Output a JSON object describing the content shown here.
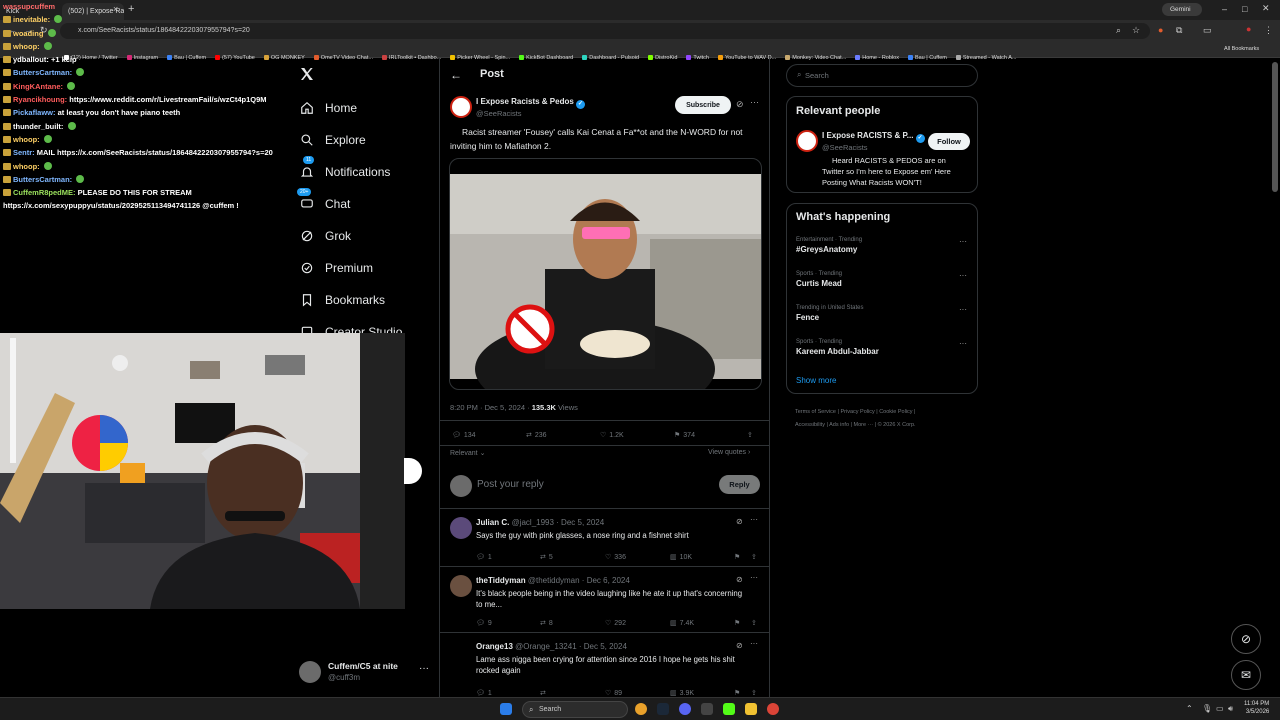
{
  "browser": {
    "tabs": [
      {
        "label": "Kick"
      },
      {
        "label": "(502) | Expose Racists & Pe"
      }
    ],
    "url": "x.com/SeeRacists/status/1864842220307955794?s=20",
    "gemini_label": "Gemini",
    "bookmarks": [
      {
        "label": "(12) Home / Twitter",
        "color": "#ffffff"
      },
      {
        "label": "Instagram",
        "color": "#d62976"
      },
      {
        "label": "Bau | Cuffem",
        "color": "#3b82f6"
      },
      {
        "label": "(57) YouTube",
        "color": "#ff0000"
      },
      {
        "label": "OG MONKEY",
        "color": "#d8a23a"
      },
      {
        "label": "OmeTV Video Chat...",
        "color": "#e25c2d"
      },
      {
        "label": "IRLToolkit • Dashbo...",
        "color": "#c94141"
      },
      {
        "label": "Picker Wheel - Spin...",
        "color": "#f0c000"
      },
      {
        "label": "KickBot Dashboard",
        "color": "#53fc18"
      },
      {
        "label": "Dashboard - Pulsoid",
        "color": "#2dd4bf"
      },
      {
        "label": "DistroKid",
        "color": "#7fff00"
      },
      {
        "label": "Twitch",
        "color": "#9146ff"
      },
      {
        "label": "YouTube to WAV D...",
        "color": "#f59e0b"
      },
      {
        "label": "Monkey: Video Chat...",
        "color": "#c8a96e"
      },
      {
        "label": "Home - Roblox",
        "color": "#6b7cff"
      },
      {
        "label": "Bau | Cuffem",
        "color": "#3b82f6"
      },
      {
        "label": "Streamed - Watch A...",
        "color": "#aaaaaa"
      }
    ],
    "all_bookmarks": "All Bookmarks"
  },
  "chat": {
    "lines": [
      {
        "user": "",
        "msg": "wassupcuffem",
        "color": "#ff6b6b"
      },
      {
        "user": "inevitable:",
        "msg": "",
        "color": "#ffd166"
      },
      {
        "user": "woading",
        "msg": "",
        "color": "#ffd166"
      },
      {
        "user": "whoop:",
        "msg": "",
        "color": "#ffd166"
      },
      {
        "user": "ydballout:",
        "msg": "+1 kcip",
        "color": "#ffffff"
      },
      {
        "user": "ButtersCartman:",
        "msg": "",
        "color": "#7fb7ff"
      },
      {
        "user": "KingKAntane:",
        "msg": "",
        "color": "#ff5c5c"
      },
      {
        "user": "Ryancikhoung:",
        "msg": "https://www.reddit.com/r/LivestreamFail/s/wzCt4p1Q9M",
        "color": "#ff5c5c"
      },
      {
        "user": "Pickaflaww:",
        "msg": "at least you don't have piano teeth",
        "color": "#7fb7ff"
      },
      {
        "user": "thunder_built:",
        "msg": "",
        "color": "#ffffff"
      },
      {
        "user": "whoop:",
        "msg": "",
        "color": "#ffd166"
      },
      {
        "user": "Sentr:",
        "msg": "MAIL https://x.com/SeeRacists/status/1864842220307955794?s=20",
        "color": "#7fb7ff"
      },
      {
        "user": "whoop:",
        "msg": "",
        "color": "#ffd166"
      },
      {
        "user": "ButtersCartman:",
        "msg": "",
        "color": "#7fb7ff"
      },
      {
        "user": "CuffemR8pedME:",
        "msg": "PLEASE DO THIS FOR STREAM",
        "color": "#9be15d"
      },
      {
        "user": "",
        "msg": "https://x.com/sexypuppyu/status/2029525113494741126 @cuffem !",
        "color": "#ffffff"
      }
    ]
  },
  "nav": {
    "items": [
      {
        "label": "Home",
        "icon": "home-icon"
      },
      {
        "label": "Explore",
        "icon": "search-icon"
      },
      {
        "label": "Notifications",
        "icon": "bell-icon",
        "badge": "11"
      },
      {
        "label": "Chat",
        "icon": "chat-icon",
        "badge": "20+"
      },
      {
        "label": "Grok",
        "icon": "grok-icon"
      },
      {
        "label": "Premium",
        "icon": "premium-icon"
      },
      {
        "label": "Bookmarks",
        "icon": "bookmark-icon"
      },
      {
        "label": "Creator Studio",
        "icon": "creator-icon"
      }
    ],
    "account": {
      "name": "Cuffem/C5 at nite",
      "handle": "@cuff3m"
    }
  },
  "post": {
    "header_title": "Post",
    "author_name": "I Expose Racists & Pedos",
    "author_handle": "@SeeRacists",
    "subscribe_label": "Subscribe",
    "text": "Racist streamer 'Fousey' calls Kai Cenat a Fa**ot and the N-WORD for not inviting him to Mafiathon 2.",
    "time": "8:20 PM · Dec 5, 2024 ·",
    "views_count": "135.3K",
    "views_label": "Views",
    "replies": "134",
    "reposts": "236",
    "likes": "1.2K",
    "bookmarks": "374",
    "sort_label": "Relevant",
    "view_quotes": "View quotes",
    "reply_placeholder": "Post your reply",
    "reply_button": "Reply"
  },
  "replies": [
    {
      "name": "Julian C.",
      "handle": "@jacl_1993 · Dec 5, 2024",
      "text": "Says the guy with pink glasses, a nose ring and a fishnet shirt",
      "replies": "1",
      "reposts": "5",
      "likes": "336",
      "views": "10K"
    },
    {
      "name": "theTiddyman",
      "handle": "@thetiddyman · Dec 6, 2024",
      "text": "It's black people being in the video laughing like he ate it up that's concerning to me...",
      "replies": "9",
      "reposts": "8",
      "likes": "292",
      "views": "7.4K"
    },
    {
      "name": "Orange13",
      "handle": "@Orange_13241 · Dec 5, 2024",
      "text": "Lame ass nigga been crying for attention since 2016 I hope he gets his shit rocked again",
      "replies": "1",
      "reposts": "",
      "likes": "89",
      "views": "3.9K"
    }
  ],
  "right": {
    "search_placeholder": "Search",
    "relevant_title": "Relevant people",
    "person_name": "I Expose RACISTS & P...",
    "person_handle": "@SeeRacists",
    "follow_label": "Follow",
    "person_bio": "Heard RACISTS & PEDOS are on Twitter so I'm here to Expose em' Here Posting What Racists WON'T!",
    "happening_title": "What's happening",
    "trends": [
      {
        "category": "Entertainment · Trending",
        "name": "#GreysAnatomy"
      },
      {
        "category": "Sports · Trending",
        "name": "Curtis Mead"
      },
      {
        "category": "Trending in United States",
        "name": "Fence"
      },
      {
        "category": "Sports · Trending",
        "name": "Kareem Abdul-Jabbar"
      }
    ],
    "show_more": "Show more",
    "footer_links": [
      "Terms of Service",
      "Privacy Policy",
      "Cookie Policy",
      "Accessibility",
      "Ads info",
      "More ···",
      "© 2026 X Corp."
    ]
  },
  "taskbar": {
    "search_label": "Search",
    "time": "11:04 PM",
    "date": "3/5/2026"
  },
  "colors": {
    "accent": "#1d9bf0",
    "background": "#000000",
    "border": "#2f3336",
    "muted": "#71767b"
  }
}
